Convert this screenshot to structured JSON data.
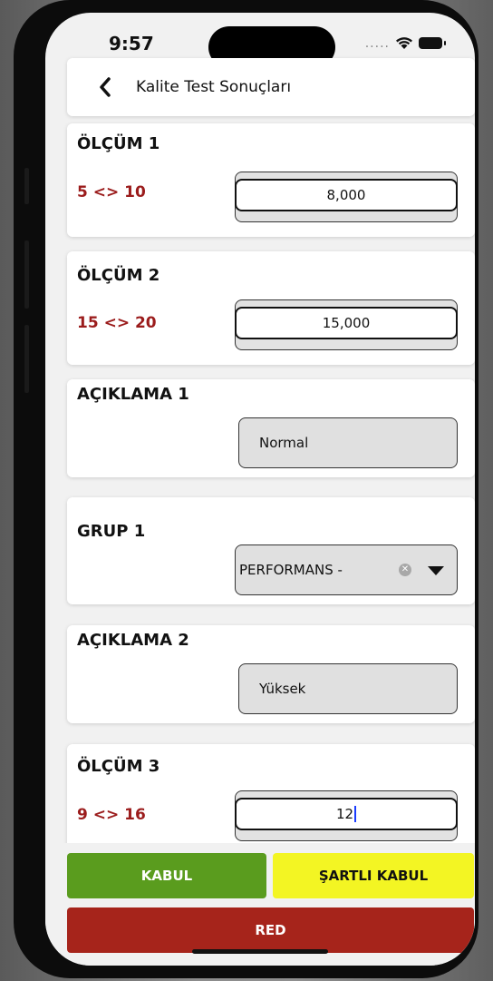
{
  "status_bar": {
    "time": "9:57",
    "dots": "....."
  },
  "header": {
    "title": "Kalite Test Sonuçları"
  },
  "cards": {
    "olcum1": {
      "title": "ÖLÇÜM 1",
      "range": "5 <> 10",
      "value": "8,000"
    },
    "olcum2": {
      "title": "ÖLÇÜM 2",
      "range": "15 <> 20",
      "value": "15,000"
    },
    "aciklama1": {
      "title": "AÇIKLAMA 1",
      "value": "Normal"
    },
    "grup1": {
      "title": "GRUP 1",
      "value": "PERFORMANS -"
    },
    "aciklama2": {
      "title": "AÇIKLAMA 2",
      "value": "Yüksek"
    },
    "olcum3": {
      "title": "ÖLÇÜM 3",
      "range": "9 <> 16",
      "value": "12"
    }
  },
  "buttons": {
    "kabul": "KABUL",
    "sartli_kabul": "ŞARTLI KABUL",
    "red": "RED"
  },
  "colors": {
    "kabul": "#5a9c1e",
    "sartli_kabul": "#f3f523",
    "red": "#a6241b",
    "range": "#9b1c1c"
  },
  "icons": {
    "back": "chevron-left-icon",
    "clear": "clear-icon",
    "dropdown": "caret-down-icon",
    "wifi": "wifi-icon",
    "battery": "battery-icon"
  }
}
